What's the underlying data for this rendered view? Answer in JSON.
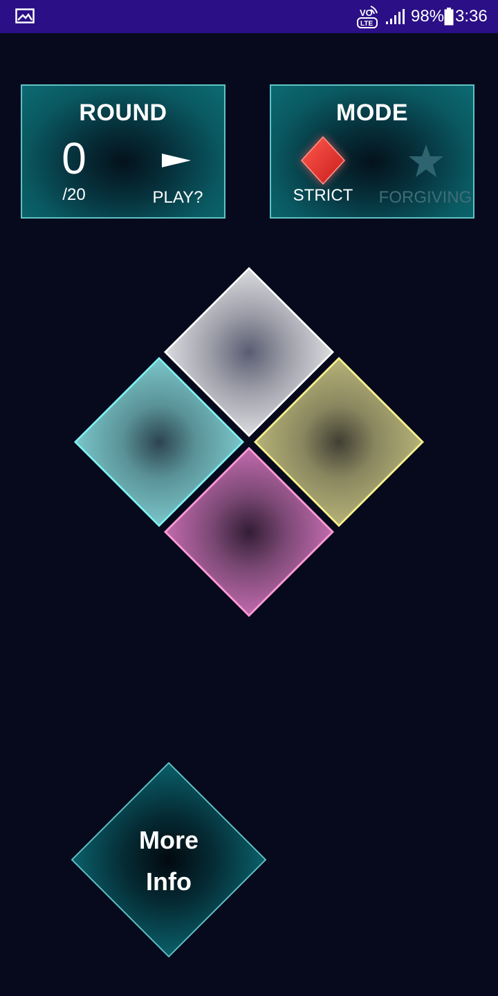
{
  "status_bar": {
    "network_label_top": "VO",
    "network_label_bottom": "LTE",
    "battery_percent": "98%",
    "time": "3:36",
    "icons": [
      "gallery-icon",
      "volte-icon",
      "signal-icon",
      "battery-icon"
    ]
  },
  "round_panel": {
    "title": "ROUND",
    "count": "0",
    "total": "/20",
    "play_label": "PLAY?",
    "play_icon": "play-icon"
  },
  "mode_panel": {
    "title": "MODE",
    "strict_label": "STRICT",
    "strict_icon": "diamond-icon",
    "strict_color": "#e8322e",
    "forgiving_label": "FORGIVING",
    "forgiving_icon": "star-icon",
    "selected": "STRICT"
  },
  "game_pads": {
    "colors": {
      "white": "#ffffff",
      "cyan": "#7ff0f0",
      "yellow": "#f7f08e",
      "pink": "#ff9ad5"
    }
  },
  "more_info": {
    "label_line1": "More",
    "label_line2": "Info"
  },
  "colors": {
    "background": "#070a1c",
    "status_bar": "#2a0f86",
    "panel_border": "#5fc3c6",
    "panel_fill": "#0a5961"
  }
}
